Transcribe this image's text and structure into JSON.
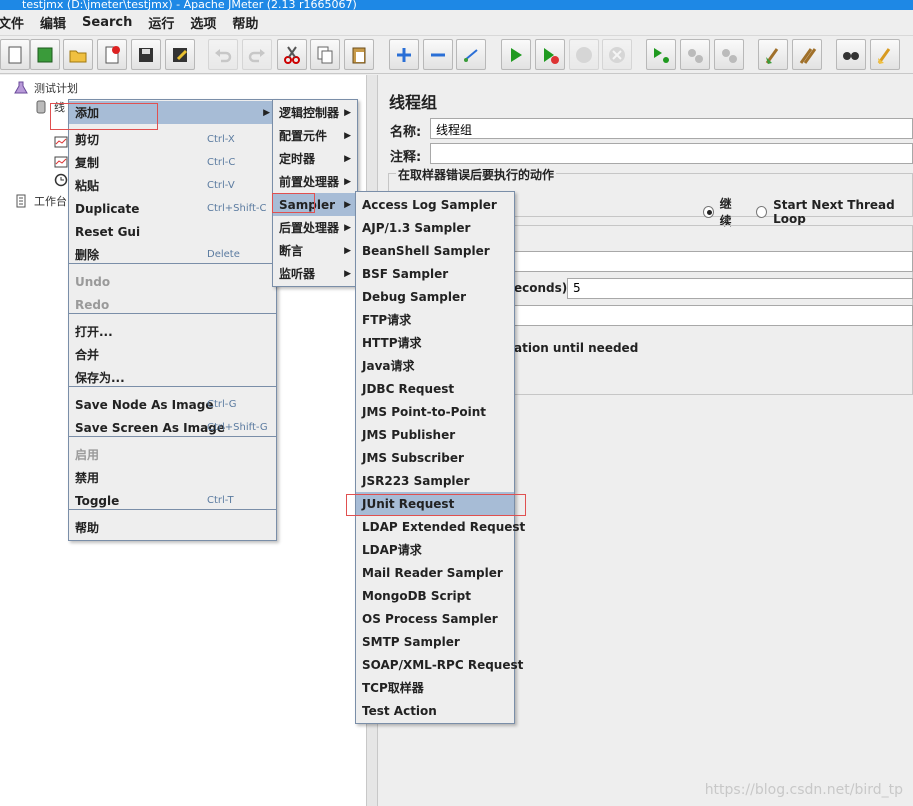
{
  "window": {
    "title": "testjmx (D:\\jmeter\\testjmx) - Apache JMeter (2.13 r1665067)"
  },
  "menubar": [
    "文件",
    "编辑",
    "Search",
    "运行",
    "选项",
    "帮助"
  ],
  "toolbar": [
    {
      "icon": "new-icon"
    },
    {
      "icon": "templates-icon"
    },
    {
      "icon": "open-icon"
    },
    {
      "icon": "close-icon"
    },
    {
      "icon": "save-icon"
    },
    {
      "icon": "save-as-icon"
    },
    {
      "icon": "undo-icon"
    },
    {
      "icon": "redo-icon"
    },
    {
      "icon": "cut-icon"
    },
    {
      "icon": "copy-icon"
    },
    {
      "icon": "paste-icon"
    },
    {
      "icon": "expand-icon"
    },
    {
      "icon": "collapse-icon"
    },
    {
      "icon": "toggle-icon"
    },
    {
      "icon": "start-icon"
    },
    {
      "icon": "start-no-pause-icon"
    },
    {
      "icon": "stop-icon"
    },
    {
      "icon": "shutdown-icon"
    },
    {
      "icon": "remote-start-icon"
    },
    {
      "icon": "remote-stop-icon"
    },
    {
      "icon": "remote-shutdown-icon"
    },
    {
      "icon": "clear-icon"
    },
    {
      "icon": "clear-all-icon"
    },
    {
      "icon": "search-icon"
    },
    {
      "icon": "reset-search-icon"
    }
  ],
  "tree": {
    "test_plan": "测试计划",
    "thread_group": "线",
    "workbench": "工作台"
  },
  "panel": {
    "title": "线程组",
    "name_label": "名称:",
    "name_value": "线程组",
    "comment_label": "注释:",
    "error_action_title": "在取样器错误后要执行的动作",
    "radio_continue": "继续",
    "radio_next_loop": "Start Next Thread Loop",
    "ramp_label_fragment": "econds):",
    "ramp_value": "5",
    "delay_fragment": "ation until needed"
  },
  "context_menu": {
    "items": [
      {
        "label": "添加",
        "accel": "",
        "submenu": true,
        "selected": true
      },
      {
        "label": "剪切",
        "accel": "Ctrl-X"
      },
      {
        "label": "复制",
        "accel": "Ctrl-C"
      },
      {
        "label": "粘贴",
        "accel": "Ctrl-V"
      },
      {
        "label": "Duplicate",
        "accel": "Ctrl+Shift-C"
      },
      {
        "label": "Reset Gui",
        "accel": ""
      },
      {
        "label": "删除",
        "accel": "Delete"
      },
      {
        "label": "Undo",
        "accel": "",
        "disabled": true
      },
      {
        "label": "Redo",
        "accel": "",
        "disabled": true
      },
      {
        "label": "打开...",
        "accel": ""
      },
      {
        "label": "合并",
        "accel": ""
      },
      {
        "label": "保存为...",
        "accel": ""
      },
      {
        "label": "Save Node As Image",
        "accel": "Ctrl-G"
      },
      {
        "label": "Save Screen As Image",
        "accel": "Ctrl+Shift-G"
      },
      {
        "label": "启用",
        "accel": "",
        "disabled": true
      },
      {
        "label": "禁用",
        "accel": ""
      },
      {
        "label": "Toggle",
        "accel": "Ctrl-T"
      },
      {
        "label": "帮助",
        "accel": ""
      }
    ]
  },
  "add_submenu": {
    "items": [
      {
        "label": "逻辑控制器"
      },
      {
        "label": "配置元件"
      },
      {
        "label": "定时器"
      },
      {
        "label": "前置处理器"
      },
      {
        "label": "Sampler",
        "selected": true
      },
      {
        "label": "后置处理器"
      },
      {
        "label": "断言"
      },
      {
        "label": "监听器"
      }
    ]
  },
  "sampler_submenu": {
    "items": [
      "Access Log Sampler",
      "AJP/1.3 Sampler",
      "BeanShell Sampler",
      "BSF Sampler",
      "Debug Sampler",
      "FTP请求",
      "HTTP请求",
      "Java请求",
      "JDBC Request",
      "JMS Point-to-Point",
      "JMS Publisher",
      "JMS Subscriber",
      "JSR223 Sampler",
      "JUnit Request",
      "LDAP Extended Request",
      "LDAP请求",
      "Mail Reader Sampler",
      "MongoDB Script",
      "OS Process Sampler",
      "SMTP Sampler",
      "SOAP/XML-RPC Request",
      "TCP取样器",
      "Test Action"
    ],
    "highlighted": "JUnit Request"
  },
  "watermark": "https://blog.csdn.net/bird_tp",
  "colors": {
    "menu_selection": "#a7bcd6",
    "menu_border": "#7a8ea8",
    "highlight_box": "#e05050"
  }
}
